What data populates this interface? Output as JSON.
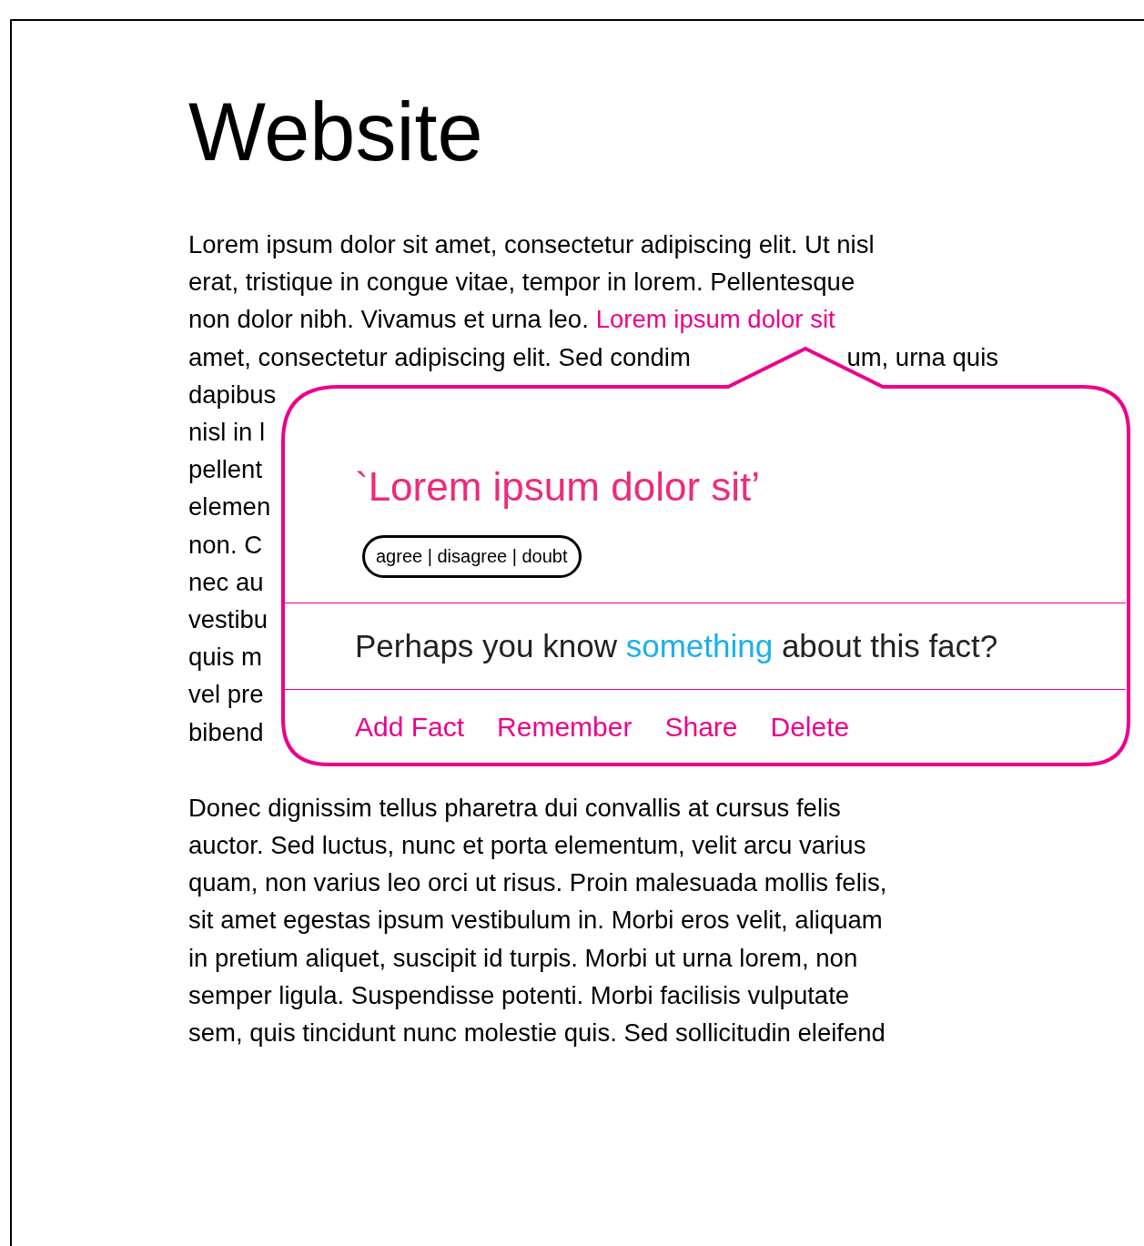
{
  "page": {
    "title": "Website",
    "paragraph_1": [
      {
        "pieces": [
          "Lorem ipsum dolor sit amet, consectetur adipiscing elit. Ut nisl"
        ]
      },
      {
        "pieces": [
          "erat, tristique in congue vitae, tempor in lorem. Pellentesque"
        ]
      },
      {
        "pieces": [
          "non dolor nibh. Vivamus et urna leo."
        ],
        "highlight": "Lorem ipsum dolor sit"
      },
      {
        "pieces": [
          "amet, consectetur adipiscing elit. Sed condim",
          "um, urna quis"
        ]
      },
      {
        "pieces": [
          "dapibus"
        ]
      },
      {
        "pieces": [
          "nisl in l"
        ]
      },
      {
        "pieces": [
          "pellent"
        ]
      },
      {
        "pieces": [
          "elemen"
        ]
      },
      {
        "pieces": [
          "non. C"
        ]
      },
      {
        "pieces": [
          "nec au"
        ]
      },
      {
        "pieces": [
          "vestibu"
        ]
      },
      {
        "pieces": [
          "quis m"
        ]
      },
      {
        "pieces": [
          "vel pre"
        ]
      },
      {
        "pieces": [
          "bibend"
        ]
      }
    ],
    "paragraph_2": [
      "Donec dignissim tellus pharetra dui convallis at cursus felis",
      "auctor. Sed luctus, nunc et porta elementum, velit arcu varius",
      "quam, non varius leo orci ut risus. Proin malesuada mollis felis,",
      "sit amet egestas ipsum vestibulum in. Morbi eros velit, aliquam",
      "in pretium aliquet, suscipit id turpis. Morbi ut urna lorem, non",
      "semper ligula. Suspendisse potenti. Morbi facilisis vulputate",
      "sem, quis tincidunt nunc molestie quis. Sed sollicitudin eleifend"
    ]
  },
  "popup": {
    "quote": "`Lorem ipsum dolor sit’",
    "opinion": "agree | disagree | doubt",
    "question": {
      "before": "Perhaps you know",
      "link": "something",
      "after": "about this fact?"
    },
    "actions": [
      "Add Fact",
      "Remember",
      "Share",
      "Delete"
    ]
  }
}
